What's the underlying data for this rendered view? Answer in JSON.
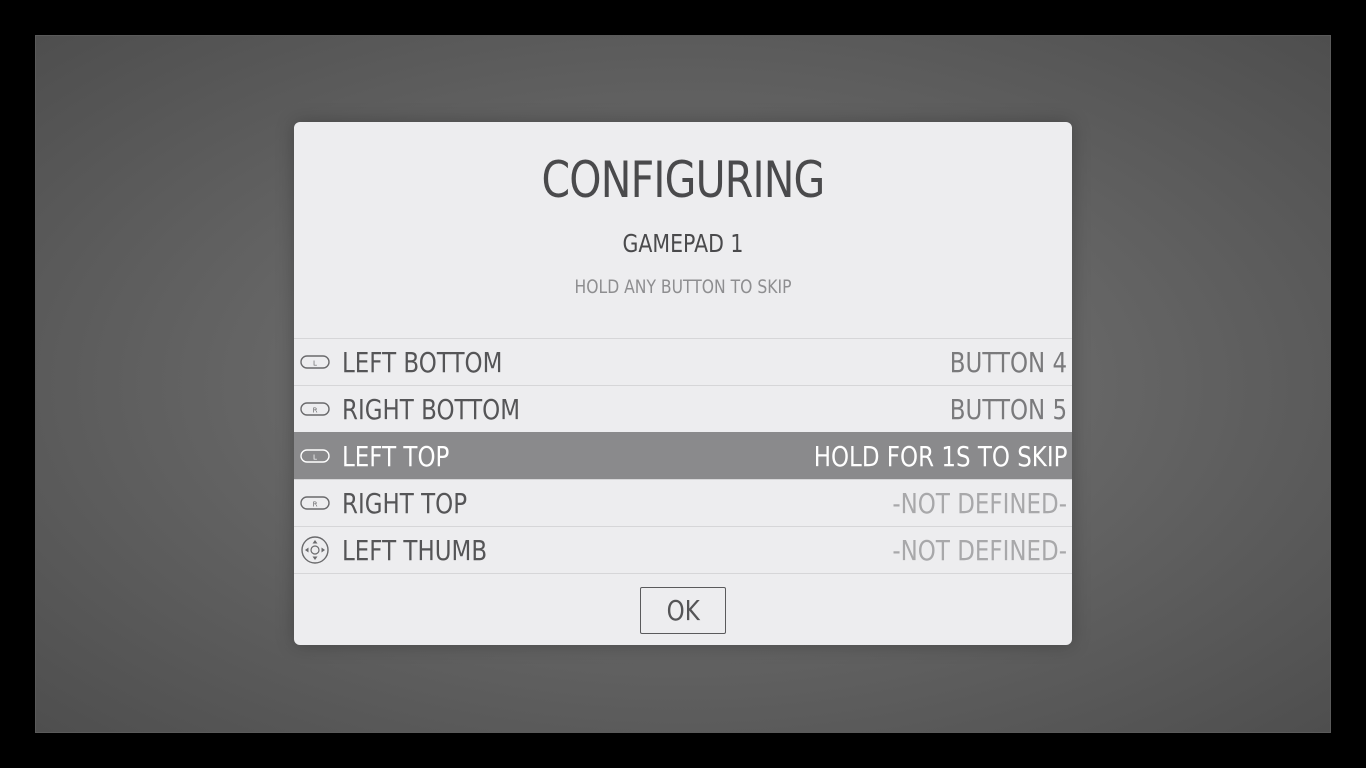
{
  "dialog": {
    "title": "CONFIGURING",
    "subtitle": "GAMEPAD 1",
    "hint": "HOLD ANY BUTTON TO SKIP",
    "ok_label": "OK"
  },
  "inputs": [
    {
      "label": "LEFT BOTTOM",
      "value": "BUTTON 4",
      "icon": "l-shoulder-icon",
      "icon_letter": "L"
    },
    {
      "label": "RIGHT BOTTOM",
      "value": "BUTTON 5",
      "icon": "r-shoulder-icon",
      "icon_letter": "R"
    },
    {
      "label": "LEFT TOP",
      "value": "HOLD FOR 1S TO SKIP",
      "icon": "l-shoulder-icon",
      "icon_letter": "L",
      "selected": true
    },
    {
      "label": "RIGHT TOP",
      "value": "-NOT DEFINED-",
      "icon": "r-shoulder-icon",
      "icon_letter": "R"
    },
    {
      "label": "LEFT THUMB",
      "value": "-NOT DEFINED-",
      "icon": "dpad-thumbstick-icon"
    }
  ],
  "colors": {
    "dialog_bg": "#ededef",
    "selected_row": "#8a8a8c",
    "text": "#555557",
    "undefined_text": "#a8a8aa"
  }
}
